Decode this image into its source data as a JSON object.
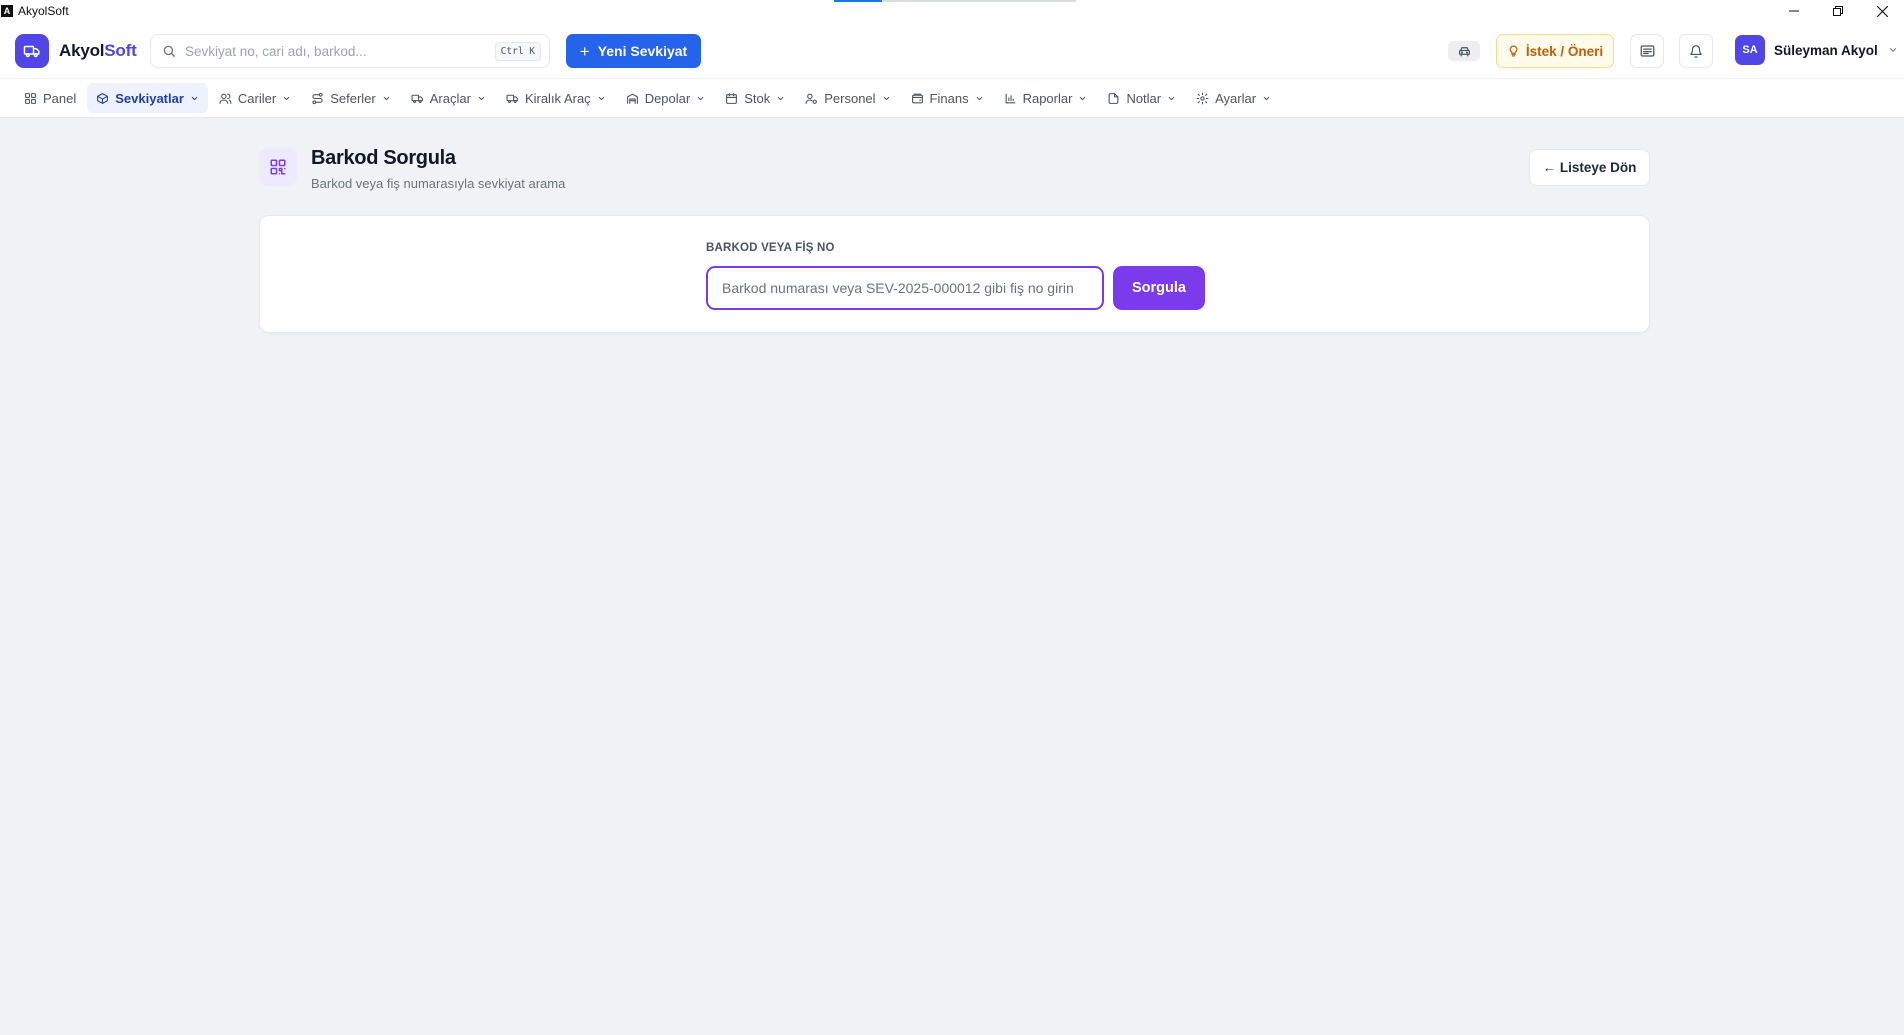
{
  "window": {
    "title": "AkyolSoft",
    "logo_letter": "A"
  },
  "header": {
    "brand_part1": "Akyol",
    "brand_part2": "Soft",
    "search": {
      "placeholder": "Sevkiyat no, cari adı, barkod...",
      "shortcut": "Ctrl K"
    },
    "new_shipment_label": "Yeni Sevkiyat",
    "request_label": "İstek / Öneri",
    "user": {
      "initials": "SA",
      "name": "Süleyman Akyol"
    }
  },
  "nav": {
    "items": [
      {
        "label": "Panel",
        "icon": "grid-icon",
        "has_dropdown": false,
        "active": false
      },
      {
        "label": "Sevkiyatlar",
        "icon": "box-icon",
        "has_dropdown": true,
        "active": true
      },
      {
        "label": "Cariler",
        "icon": "users-icon",
        "has_dropdown": true,
        "active": false
      },
      {
        "label": "Seferler",
        "icon": "route-icon",
        "has_dropdown": true,
        "active": false
      },
      {
        "label": "Araçlar",
        "icon": "truck-icon",
        "has_dropdown": true,
        "active": false
      },
      {
        "label": "Kiralık Araç",
        "icon": "truck-icon",
        "has_dropdown": true,
        "active": false
      },
      {
        "label": "Depolar",
        "icon": "warehouse-icon",
        "has_dropdown": true,
        "active": false
      },
      {
        "label": "Stok",
        "icon": "calendar-icon",
        "has_dropdown": true,
        "active": false
      },
      {
        "label": "Personel",
        "icon": "user-gear-icon",
        "has_dropdown": true,
        "active": false
      },
      {
        "label": "Finans",
        "icon": "wallet-icon",
        "has_dropdown": true,
        "active": false
      },
      {
        "label": "Raporlar",
        "icon": "bar-chart-icon",
        "has_dropdown": true,
        "active": false
      },
      {
        "label": "Notlar",
        "icon": "note-icon",
        "has_dropdown": true,
        "active": false
      },
      {
        "label": "Ayarlar",
        "icon": "gear-icon",
        "has_dropdown": true,
        "active": false
      }
    ]
  },
  "page": {
    "title": "Barkod Sorgula",
    "subtitle": "Barkod veya fiş numarasıyla sevkiyat arama",
    "back_label": "← Listeye Dön",
    "field_label": "BARKOD VEYA FİŞ NO",
    "input_placeholder": "Barkod numarası veya SEV-2025-000012 gibi fiş no girin",
    "input_value": "",
    "query_label": "Sorgula"
  },
  "colors": {
    "brand": "#4f46e5",
    "primary_button": "#2563eb",
    "accent_purple": "#7c3aed",
    "request_text": "#c25e09",
    "nav_active_bg": "#eef2ff",
    "nav_active_text": "#1e40af",
    "page_bg": "#f1f2f6"
  }
}
